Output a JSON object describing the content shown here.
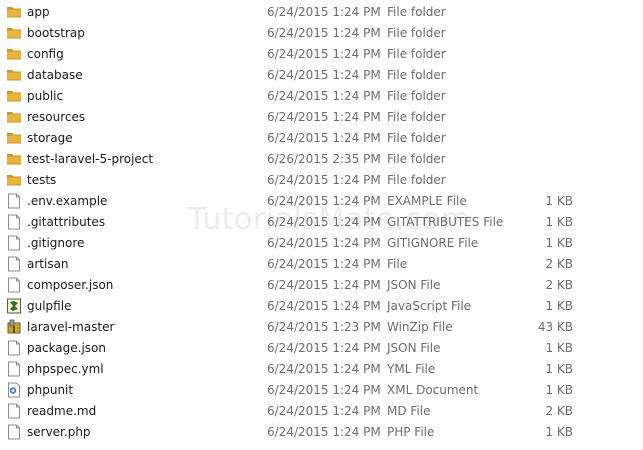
{
  "watermark": "TutorialsMate.com",
  "colors": {
    "folder": "#e8b440",
    "folder_dark": "#c9962a",
    "file_border": "#8c8c8c",
    "date_text": "#6d6d6d",
    "name_text": "#1b1b1b"
  },
  "files": [
    {
      "name": "app",
      "date": "6/24/2015 1:24 PM",
      "type": "File folder",
      "size": "",
      "icon": "folder-icon"
    },
    {
      "name": "bootstrap",
      "date": "6/24/2015 1:24 PM",
      "type": "File folder",
      "size": "",
      "icon": "folder-icon"
    },
    {
      "name": "config",
      "date": "6/24/2015 1:24 PM",
      "type": "File folder",
      "size": "",
      "icon": "folder-icon"
    },
    {
      "name": "database",
      "date": "6/24/2015 1:24 PM",
      "type": "File folder",
      "size": "",
      "icon": "folder-icon"
    },
    {
      "name": "public",
      "date": "6/24/2015 1:24 PM",
      "type": "File folder",
      "size": "",
      "icon": "folder-icon"
    },
    {
      "name": "resources",
      "date": "6/24/2015 1:24 PM",
      "type": "File folder",
      "size": "",
      "icon": "folder-icon"
    },
    {
      "name": "storage",
      "date": "6/24/2015 1:24 PM",
      "type": "File folder",
      "size": "",
      "icon": "folder-icon"
    },
    {
      "name": "test-laravel-5-project",
      "date": "6/26/2015 2:35 PM",
      "type": "File folder",
      "size": "",
      "icon": "folder-icon"
    },
    {
      "name": "tests",
      "date": "6/24/2015 1:24 PM",
      "type": "File folder",
      "size": "",
      "icon": "folder-icon"
    },
    {
      "name": ".env.example",
      "date": "6/24/2015 1:24 PM",
      "type": "EXAMPLE File",
      "size": "1 KB",
      "icon": "file-icon"
    },
    {
      "name": ".gitattributes",
      "date": "6/24/2015 1:24 PM",
      "type": "GITATTRIBUTES File",
      "size": "1 KB",
      "icon": "file-icon"
    },
    {
      "name": ".gitignore",
      "date": "6/24/2015 1:24 PM",
      "type": "GITIGNORE File",
      "size": "1 KB",
      "icon": "file-icon"
    },
    {
      "name": "artisan",
      "date": "6/24/2015 1:24 PM",
      "type": "File",
      "size": "2 KB",
      "icon": "file-icon"
    },
    {
      "name": "composer.json",
      "date": "6/24/2015 1:24 PM",
      "type": "JSON File",
      "size": "2 KB",
      "icon": "file-icon"
    },
    {
      "name": "gulpfile",
      "date": "6/24/2015 1:24 PM",
      "type": "JavaScript File",
      "size": "1 KB",
      "icon": "javascript-file-icon"
    },
    {
      "name": "laravel-master",
      "date": "6/24/2015 1:23 PM",
      "type": "WinZip File",
      "size": "43 KB",
      "icon": "zip-file-icon"
    },
    {
      "name": "package.json",
      "date": "6/24/2015 1:24 PM",
      "type": "JSON File",
      "size": "1 KB",
      "icon": "file-icon"
    },
    {
      "name": "phpspec.yml",
      "date": "6/24/2015 1:24 PM",
      "type": "YML File",
      "size": "1 KB",
      "icon": "file-icon"
    },
    {
      "name": "phpunit",
      "date": "6/24/2015 1:24 PM",
      "type": "XML Document",
      "size": "1 KB",
      "icon": "xml-file-icon"
    },
    {
      "name": "readme.md",
      "date": "6/24/2015 1:24 PM",
      "type": "MD File",
      "size": "2 KB",
      "icon": "file-icon"
    },
    {
      "name": "server.php",
      "date": "6/24/2015 1:24 PM",
      "type": "PHP File",
      "size": "1 KB",
      "icon": "file-icon"
    }
  ]
}
